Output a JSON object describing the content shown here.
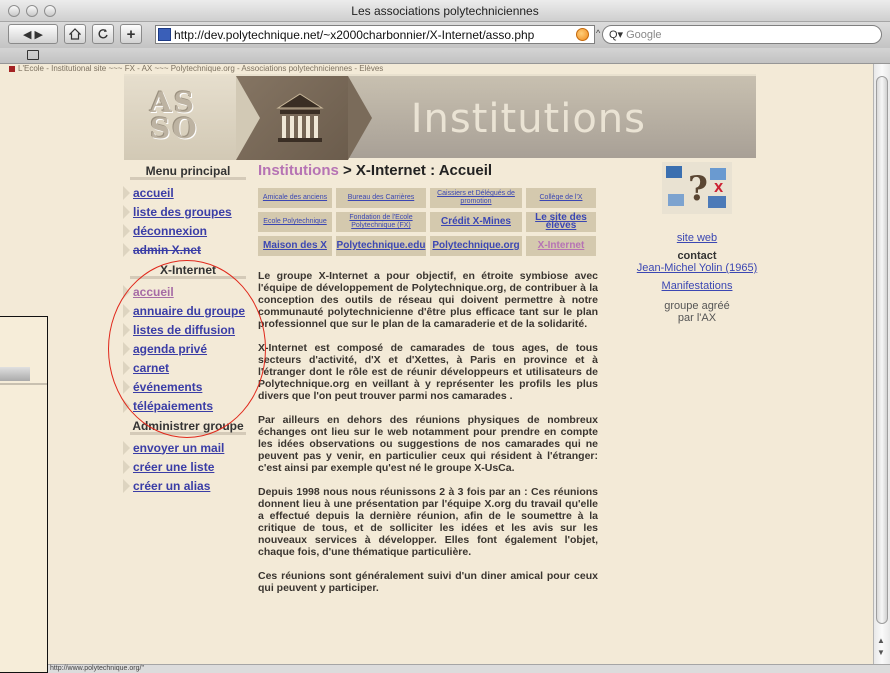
{
  "window": {
    "title": "Les associations polytechniciennes"
  },
  "toolbar": {
    "back_forward": "◀ ▶",
    "home_icon": "home-icon",
    "reload_icon": "reload-icon",
    "add_icon": "add-icon",
    "url": "http://dev.polytechnique.net/~x2000charbonnier/X-Internet/asso.php",
    "search_placeholder": "Google",
    "search_prefix": "Q▾"
  },
  "bookmarks": {
    "icon": "book-icon"
  },
  "breadcrumb": "L'Ecole - Institutional site ~~~ FX - AX ~~~ Polytechnique.org - Associations polytechniciennes - Elèves",
  "banner": {
    "logo_text_1": "AS",
    "logo_text_2": "SO",
    "title": "Institutions"
  },
  "nav": {
    "main_heading": "Menu principal",
    "main_items": [
      {
        "label": "accueil"
      },
      {
        "label": "liste des groupes"
      },
      {
        "label": "déconnexion"
      },
      {
        "label": "admin X.net"
      }
    ],
    "group_heading": "X-Internet",
    "group_items": [
      {
        "label": "accueil"
      },
      {
        "label": "annuaire du groupe"
      },
      {
        "label": "listes de diffusion"
      },
      {
        "label": "agenda privé"
      },
      {
        "label": "carnet"
      },
      {
        "label": "événements"
      },
      {
        "label": "télépaiements"
      }
    ],
    "admin_heading": "Administrer groupe",
    "admin_items": [
      {
        "label": "envoyer un mail"
      },
      {
        "label": "créer une liste"
      },
      {
        "label": "créer un alias"
      }
    ]
  },
  "content": {
    "crumb": "Institutions",
    "title": " > X-Internet : Accueil",
    "buttons": [
      "Amicale des anciens",
      "Bureau des Carrières",
      "Caissiers et Délégués de promotion",
      "Collège de l'X",
      "Ecole Polytechnique",
      "Fondation de l'Ecole Polytechnique (FX)",
      "Crédit X-Mines",
      "Le site des élèves",
      "Maison des X",
      "Polytechnique.edu",
      "Polytechnique.org",
      "X-Internet"
    ],
    "paragraphs": [
      "Le groupe X-Internet a pour objectif, en étroite symbiose avec l'équipe de développement de Polytechnique.org, de contribuer à la conception des outils de réseau qui doivent permettre à notre communauté polytechnicienne d'être plus efficace tant sur le plan professionnel que sur le plan de la camaraderie et de la solidarité.",
      "X-Internet est composé de camarades de tous ages, de tous secteurs d'activité, d'X et d'Xettes, à Paris en province et à l'étranger dont le rôle est de réunir développeurs et utilisateurs de Polytechnique.org en veillant à y représenter les profils les plus divers que l'on peut trouver parmi nos camarades .",
      "Par ailleurs en dehors des réunions physiques de nombreux échanges ont lieu sur le web notamment pour prendre en compte les idées observations ou suggestions de nos camarades qui ne peuvent pas y venir, en particulier ceux qui résident à l'étranger: c'est ainsi par exemple qu'est né le groupe X-UsCa.",
      "Depuis 1998 nous nous réunissons 2 à 3 fois par an : Ces réunions donnent lieu à une présentation par l'équipe X.org du travail qu'elle a effectué depuis la dernière réunion, afin de le soumettre à la critique de tous, et de solliciter les idées et les avis sur les nouveaux services à développer. Elles font également l'objet, chaque fois, d'une thématique particulière.",
      "Ces réunions sont généralement suivi d'un diner amical pour ceux qui peuvent y participer."
    ]
  },
  "right": {
    "site_web": "site web",
    "contact_label": "contact",
    "contact_name": "Jean-Michel Yolin (1965)",
    "manifestations": "Manifestations",
    "agree_line1": "groupe agréé",
    "agree_line2": "par l'AX"
  },
  "status": {
    "text": "http://www.polytechnique.org/\""
  },
  "colors": {
    "page_bg": "#f3ead7",
    "link": "#3a3da6",
    "visited": "#a66ba5",
    "annotation_ring": "#e0281b"
  }
}
